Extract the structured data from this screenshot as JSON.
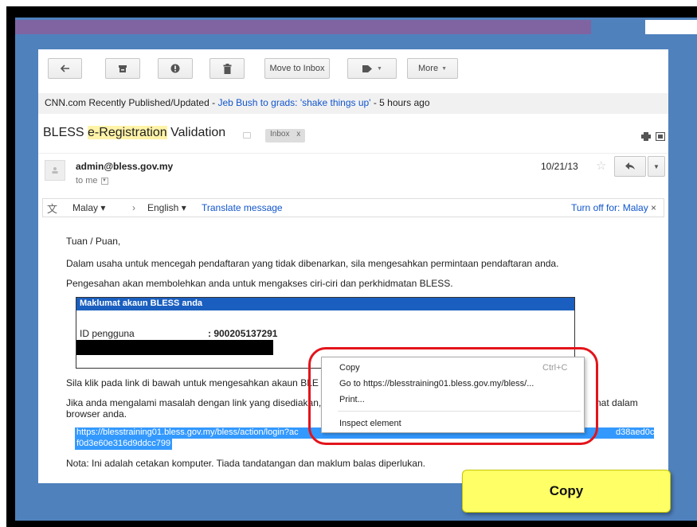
{
  "toolbar": {
    "move_to_inbox_label": "Move to Inbox",
    "more_label": "More"
  },
  "feed": {
    "source": "CNN.com Recently Published/Updated - ",
    "headline": "Jeb Bush to grads: 'shake things up'",
    "age": " - 5 hours ago"
  },
  "subject": {
    "prefix": "BLESS ",
    "highlight": "e-Registration",
    "suffix": " Validation",
    "label_chip": "Inbox"
  },
  "sender": {
    "email": "admin@bless.gov.my",
    "to": "to me",
    "date": "10/21/13"
  },
  "translate": {
    "from_lang": "Malay",
    "to_lang": "English",
    "translate_link": "Translate message",
    "turn_off": "Turn off for: Malay"
  },
  "body": {
    "greeting": "Tuan / Puan,",
    "para1": "Dalam usaha untuk mencegah pendaftaran yang tidak dibenarkan, sila mengesahkan permintaan pendaftaran anda.",
    "para2": "Pengesahan akan membolehkan anda untuk mengakses ciri-ciri dan perkhidmatan BLESS.",
    "box_title": "Maklumat akaun BLESS anda",
    "user_id_label": "ID pengguna",
    "user_id_value": ": 900205137291",
    "para3": "Sila klik pada link di bawah untuk mengesahkan akaun BLE",
    "para4_a": "Jika anda mengalami masalah dengan link yang disediakan,",
    "para4_end": "nat dalam",
    "para4_b": "browser anda.",
    "url_line1": "https://blesstraining01.bless.gov.my/bless/action/login?ac",
    "url_line1_end": "d38aed0c",
    "url_line2": "f0d3e60e316d9ddcc799",
    "note": "Nota: Ini adalah cetakan komputer. Tiada tandatangan dan maklum balas diperlukan."
  },
  "context_menu": {
    "copy": "Copy",
    "copy_shortcut": "Ctrl+C",
    "goto": "Go to https://blesstraining01.bless.gov.my/bless/...",
    "print": "Print...",
    "inspect": "Inspect element"
  },
  "callout": {
    "copy_label": "Copy"
  },
  "colors": {
    "slide_bg": "#4f81bd",
    "title_bar": "#8064a2",
    "selection": "#3399ff",
    "ring": "#e3141b",
    "callout": "#ffff66"
  }
}
